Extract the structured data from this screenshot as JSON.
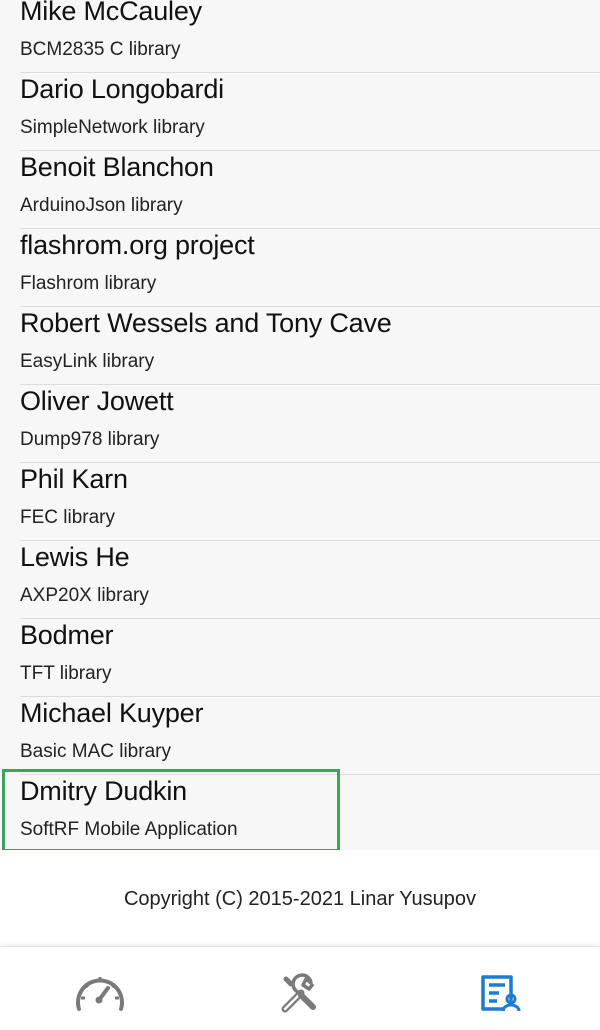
{
  "credits": [
    {
      "name": "Mike McCauley",
      "desc": "BCM2835 C library"
    },
    {
      "name": "Dario Longobardi",
      "desc": "SimpleNetwork library"
    },
    {
      "name": "Benoit Blanchon",
      "desc": "ArduinoJson library"
    },
    {
      "name": "flashrom.org project",
      "desc": "Flashrom library"
    },
    {
      "name": "Robert Wessels and Tony Cave",
      "desc": "EasyLink library"
    },
    {
      "name": "Oliver Jowett",
      "desc": "Dump978 library"
    },
    {
      "name": "Phil Karn",
      "desc": "FEC library"
    },
    {
      "name": "Lewis He",
      "desc": "AXP20X library"
    },
    {
      "name": "Bodmer",
      "desc": "TFT library"
    },
    {
      "name": "Michael Kuyper",
      "desc": "Basic MAC library"
    },
    {
      "name": "Dmitry Dudkin",
      "desc": "SoftRF Mobile Application"
    }
  ],
  "footer": {
    "copyright": "Copyright (C) 2015-2021 Linar Yusupov"
  },
  "tabs": [
    {
      "icon": "speedometer-icon",
      "active": false
    },
    {
      "icon": "wrench-icon",
      "active": false
    },
    {
      "icon": "contacts-icon",
      "active": true
    }
  ],
  "colors": {
    "highlight": "#3aa655",
    "active_tab": "#1e7bd0",
    "inactive_tab": "#7a7a7a",
    "list_bg": "#f7f7f7"
  }
}
